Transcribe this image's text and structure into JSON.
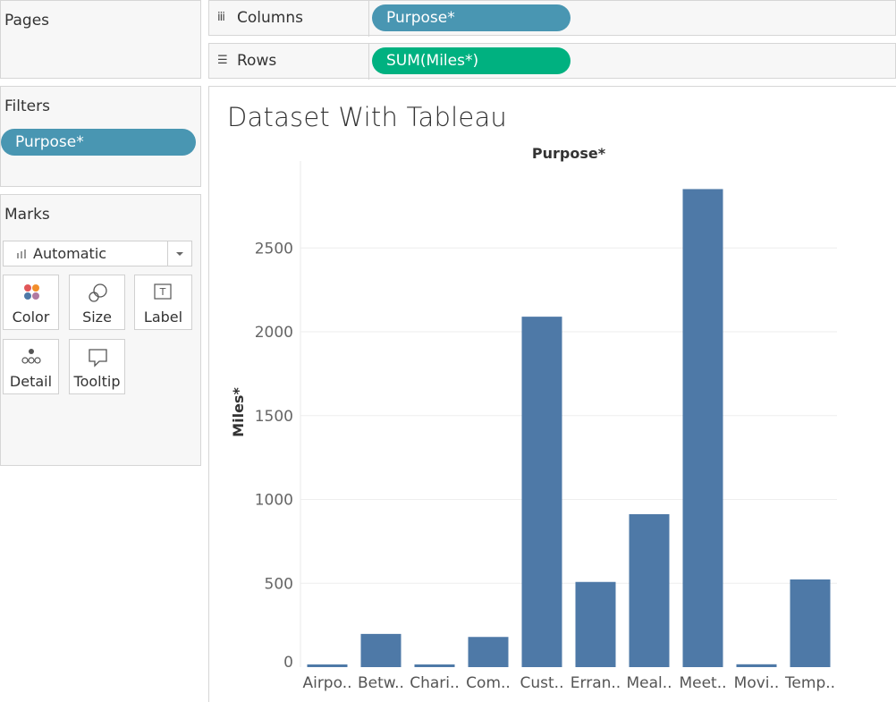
{
  "pages": {
    "title": "Pages"
  },
  "filters": {
    "title": "Filters",
    "pill": "Purpose*"
  },
  "marks": {
    "title": "Marks",
    "type_selected": "Automatic",
    "buttons": [
      {
        "label": "Color",
        "icon": "color-icon"
      },
      {
        "label": "Size",
        "icon": "size-icon"
      },
      {
        "label": "Label",
        "icon": "label-icon"
      },
      {
        "label": "Detail",
        "icon": "detail-icon"
      },
      {
        "label": "Tooltip",
        "icon": "tooltip-icon"
      }
    ]
  },
  "shelves": {
    "columns": {
      "label": "Columns",
      "pill": "Purpose*"
    },
    "rows": {
      "label": "Rows",
      "pill": "SUM(Miles*)"
    }
  },
  "view": {
    "title": "Dataset With Tableau"
  },
  "colors": {
    "dimension": "#4996b2",
    "measure": "#00b180",
    "bar": "#4e79a7"
  },
  "chart_data": {
    "type": "bar",
    "title": "Purpose*",
    "ylabel": "Miles*",
    "categories": [
      "Airpo..",
      "Betw..",
      "Chari..",
      "Com..",
      "Cust..",
      "Erran..",
      "Meal..",
      "Meet..",
      "Movi..",
      "Temp.."
    ],
    "values": [
      16,
      198,
      16,
      180,
      2090,
      508,
      912,
      2851,
      17,
      523
    ],
    "yticks": [
      0,
      500,
      1000,
      1500,
      2000,
      2500
    ],
    "ylim": [
      0,
      2976
    ],
    "grid": true
  }
}
